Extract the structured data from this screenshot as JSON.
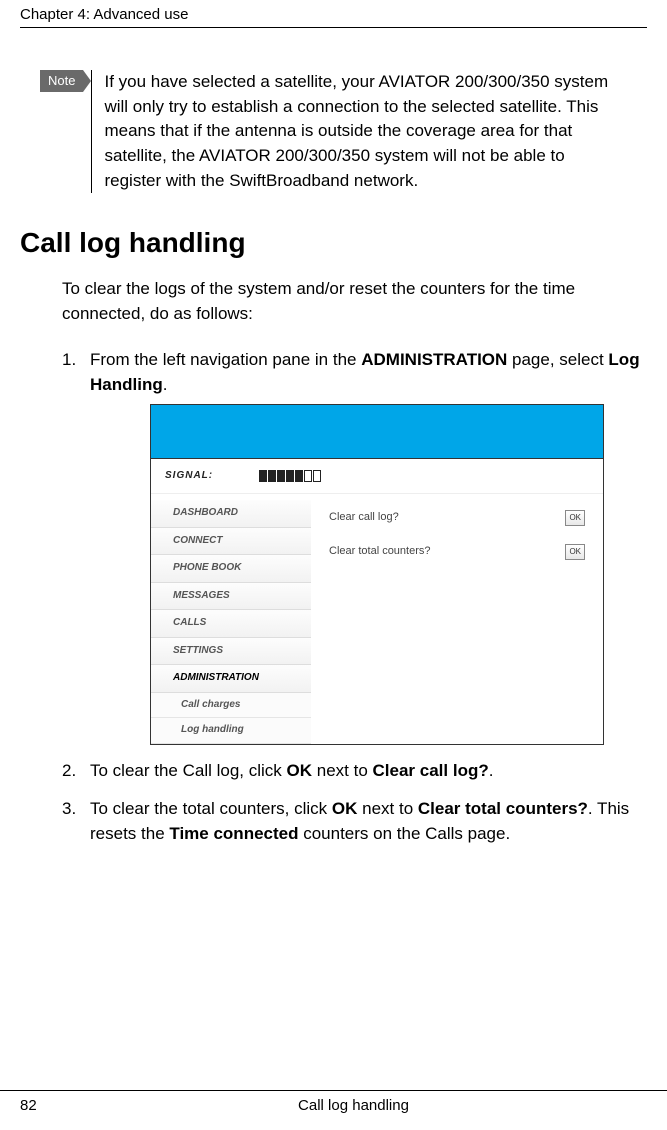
{
  "header": {
    "chapter": "Chapter 4:  Advanced use"
  },
  "note": {
    "label": "Note",
    "text": "If you have selected a satellite, your AVIATOR 200/300/350 system will only try to establish a connection to the selected satellite. This means that if the antenna is outside the coverage area for that satellite, the AVIATOR 200/300/350 system will not be able to register with the SwiftBroadband network."
  },
  "section_title": "Call log handling",
  "intro": "To clear the logs of the system and/or reset the counters for the time connected, do as follows:",
  "steps": {
    "s1": {
      "num": "1.",
      "pre": "From the left navigation pane in the ",
      "b1": "ADMINISTRATION",
      "mid": " page, select ",
      "b2": "Log Handling",
      "post": "."
    },
    "s2": {
      "num": "2.",
      "pre": "To clear the Call log, click ",
      "b1": "OK",
      "mid": " next to ",
      "b2": "Clear call log?",
      "post": "."
    },
    "s3": {
      "num": "3.",
      "pre": "To clear the total counters, click ",
      "b1": "OK",
      "mid1": " next to ",
      "b2": "Clear total counters?",
      "mid2": ". This resets the ",
      "b3": "Time connected",
      "post": " counters on the Calls page."
    }
  },
  "screenshot": {
    "signal_label": "SIGNAL:",
    "nav": {
      "dashboard": "DASHBOARD",
      "connect": "CONNECT",
      "phonebook": "PHONE BOOK",
      "messages": "MESSAGES",
      "calls": "CALLS",
      "settings": "SETTINGS",
      "administration": "ADMINISTRATION",
      "call_charges": "Call charges",
      "log_handling": "Log handling"
    },
    "content": {
      "clear_call_log": "Clear call log?",
      "clear_total_counters": "Clear total counters?",
      "ok": "OK"
    }
  },
  "footer": {
    "page": "82",
    "title": "Call log handling"
  }
}
